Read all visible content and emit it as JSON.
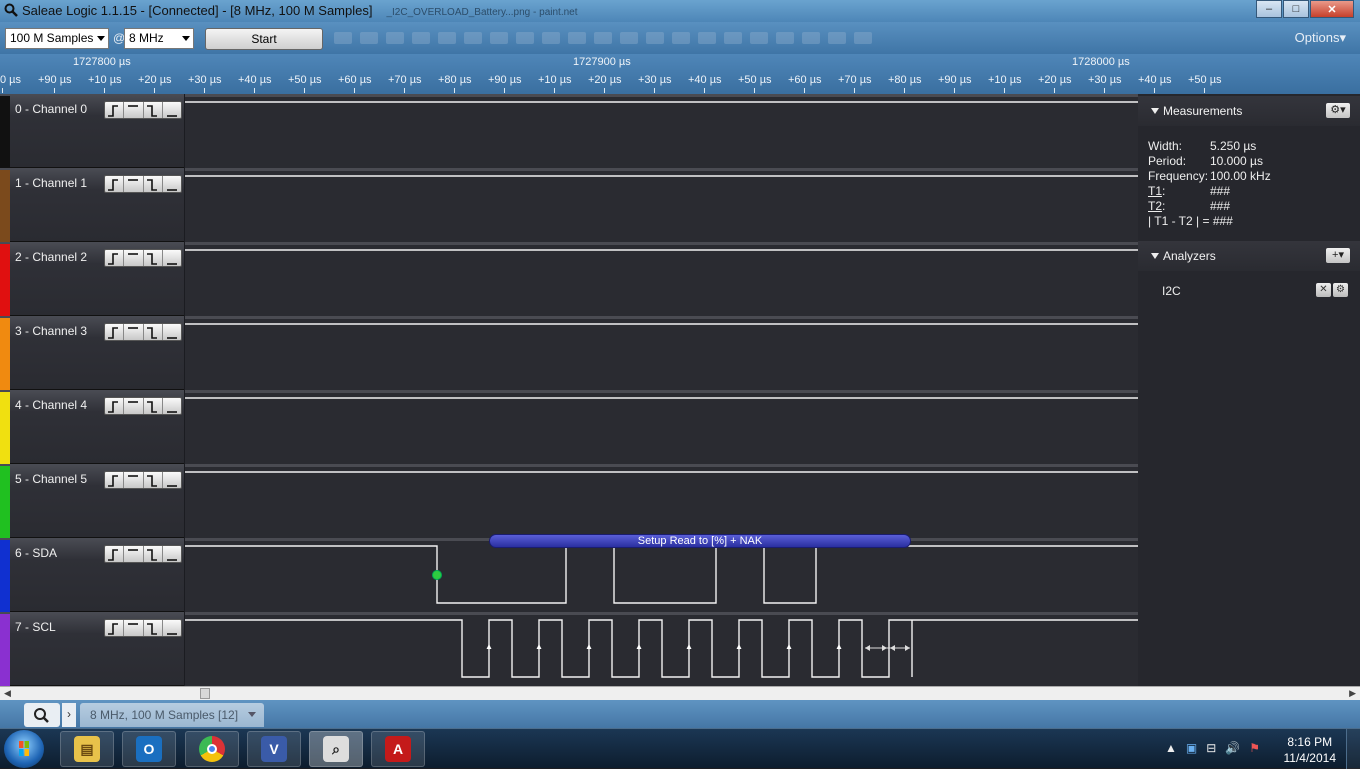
{
  "window": {
    "title": "Saleae Logic 1.1.15 - [Connected] - [8 MHz, 100 M Samples]",
    "title_extra": "_I2C_OVERLOAD_Battery...png - paint.net",
    "minimize": "–",
    "maximize": "□",
    "close": "✕"
  },
  "toolbar": {
    "samples_value": "100 M Samples",
    "at": "@",
    "rate_value": "8 MHz",
    "start_label": "Start",
    "options_label": "Options▾"
  },
  "ruler": {
    "major": [
      "1727800 µs",
      "1727900 µs",
      "1728000 µs"
    ],
    "ticks": [
      "0 µs",
      "+90 µs",
      "+10 µs",
      "+20 µs",
      "+30 µs",
      "+40 µs",
      "+50 µs",
      "+60 µs",
      "+70 µs",
      "+80 µs",
      "+90 µs",
      "+10 µs",
      "+20 µs",
      "+30 µs",
      "+40 µs",
      "+50 µs",
      "+60 µs",
      "+70 µs",
      "+80 µs",
      "+90 µs",
      "+10 µs",
      "+20 µs",
      "+30 µs",
      "+40 µs",
      "+50 µs"
    ]
  },
  "channels": [
    {
      "name": "0 - Channel 0",
      "color": "#111111"
    },
    {
      "name": "1 - Channel 1",
      "color": "#7b4a1c"
    },
    {
      "name": "2 - Channel 2",
      "color": "#e01010"
    },
    {
      "name": "3 - Channel 3",
      "color": "#f08a10"
    },
    {
      "name": "4 - Channel 4",
      "color": "#f0e010"
    },
    {
      "name": "5 - Channel 5",
      "color": "#20c020"
    },
    {
      "name": "6 - SDA",
      "color": "#1030d0"
    },
    {
      "name": "7 - SCL",
      "color": "#8a30d0"
    }
  ],
  "trigger_icons": [
    "rising-edge-icon",
    "high-level-icon",
    "falling-edge-icon",
    "low-level-icon"
  ],
  "decode_bubble": "Setup Read to [%] + NAK",
  "measurements": {
    "header": "Measurements",
    "width_label": "Width:",
    "width_value": "5.250 µs",
    "period_label": "Period:",
    "period_value": "10.000 µs",
    "frequency_label": "Frequency:",
    "frequency_value": "100.00 kHz",
    "t1_label": "T1",
    "t1_value": "###",
    "t2_label": "T2",
    "t2_value": "###",
    "diff_label": "| T1 - T2 | =",
    "diff_value": "###"
  },
  "analyzers": {
    "header": "Analyzers",
    "add_label": "+▾",
    "items": [
      {
        "name": "I2C"
      }
    ]
  },
  "bottom": {
    "tab_label": "8 MHz, 100 M Samples [12]",
    "tab_separator": "›"
  },
  "taskbar": {
    "time": "8:16 PM",
    "date": "11/4/2014",
    "apps": [
      "file-explorer-icon",
      "outlook-icon",
      "chrome-icon",
      "visual-micro-icon",
      "logic-analyzer-icon",
      "acrobat-icon"
    ]
  }
}
